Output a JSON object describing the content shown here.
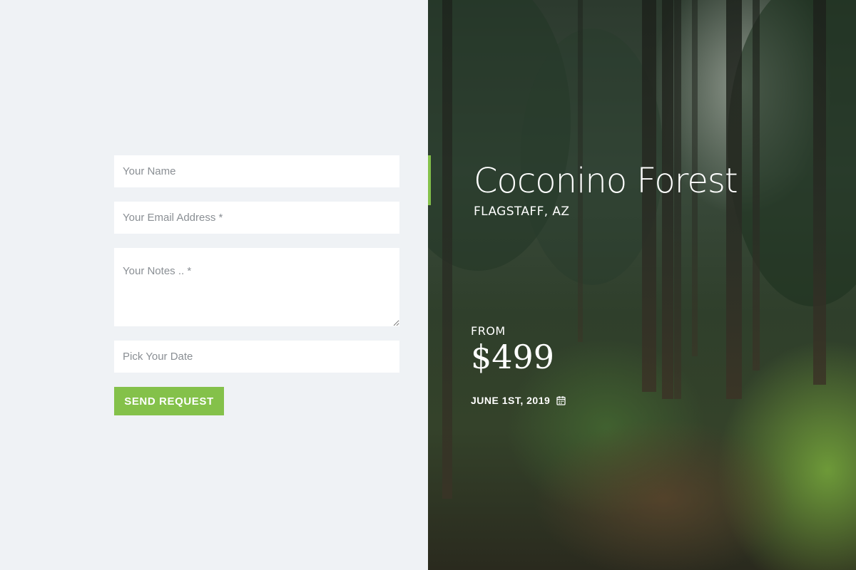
{
  "form": {
    "name_placeholder": "Your Name",
    "email_placeholder": "Your Email Address *",
    "notes_placeholder": "Your Notes .. *",
    "date_placeholder": "Pick Your Date",
    "submit_label": "SEND REQUEST"
  },
  "hero": {
    "title": "Coconino Forest",
    "location": "FLAGSTAFF, AZ",
    "price_prefix": "FROM",
    "price": "$499",
    "date": "JUNE 1ST, 2019",
    "date_icon": "calendar-icon",
    "background": "forest-photo"
  },
  "colors": {
    "accent": "#84c14a",
    "panel_bg": "#eff2f5",
    "field_bg": "#ffffff"
  }
}
